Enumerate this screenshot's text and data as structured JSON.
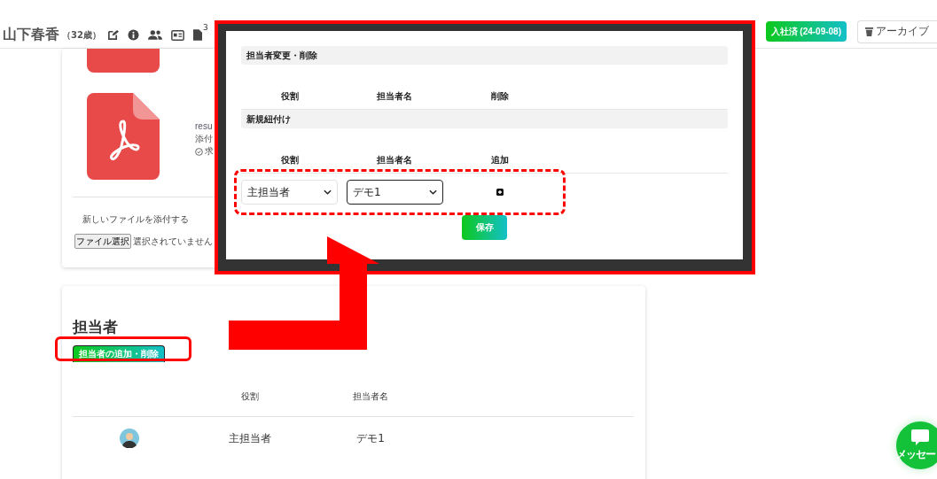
{
  "header": {
    "name": "山下春香",
    "age": "（32歳）",
    "doc_count": "3",
    "status_button": "入社済 (24-09-08)",
    "archive_button": "アーカイブ"
  },
  "files_card": {
    "partial_filename": "resu",
    "partial_label": "添付",
    "partial_status": "求",
    "attach_label": "新しいファイルを添付する",
    "file_button": "ファイル選択",
    "file_status": "選択されていません"
  },
  "staff_card": {
    "title": "担当者",
    "edit_button": "担当者の追加・削除",
    "columns": [
      "役割",
      "担当者名"
    ],
    "rows": [
      {
        "role": "主担当者",
        "name": "デモ1"
      }
    ]
  },
  "inset": {
    "sections": [
      {
        "title": "担当者変更・削除",
        "columns": [
          "役割",
          "担当者名",
          "削除"
        ]
      },
      {
        "title": "新規紐付け",
        "columns": [
          "役割",
          "担当者名",
          "追加"
        ],
        "selects": [
          {
            "value": "主担当者",
            "focused": false
          },
          {
            "value": "デモ1",
            "focused": true
          }
        ]
      }
    ],
    "save_button": "保存"
  },
  "chat_button": {
    "label": "メッセー"
  }
}
